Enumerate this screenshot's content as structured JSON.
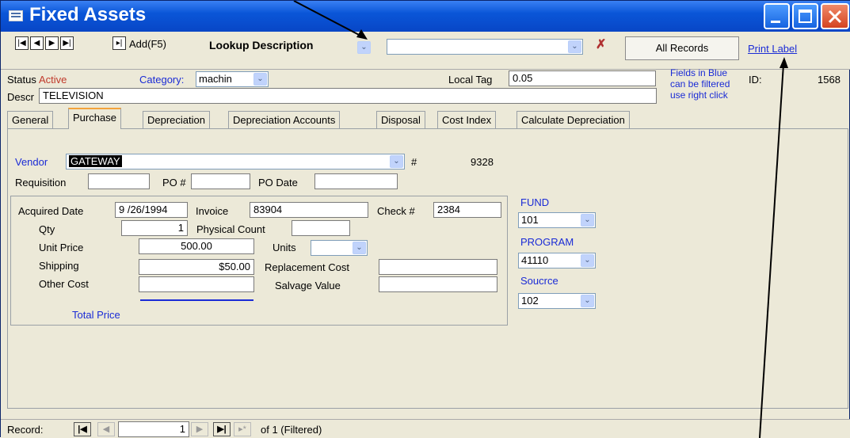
{
  "window": {
    "title": "Fixed Assets"
  },
  "toolbar": {
    "add_label": "Add(F5)",
    "lookup_label": "Lookup Description",
    "all_records_label": "All Records",
    "print_label_link": "Print Label"
  },
  "header": {
    "status_label": "Status",
    "status_value": "Active",
    "category_label": "Category:",
    "category_value": "machin",
    "local_tag_label": "Local Tag",
    "local_tag_value": "0.05",
    "hint_line1": "Fields in Blue",
    "hint_line2": "can be filtered",
    "hint_line3": "use right click",
    "id_label": "ID:",
    "id_value": "1568",
    "descr_label": "Descr",
    "descr_value": "TELEVISION"
  },
  "tabs": [
    "General",
    "Purchase",
    "Depreciation",
    "Depreciation Accounts",
    "Disposal",
    "Cost Index",
    "Calculate Depreciation"
  ],
  "purchase": {
    "vendor_label": "Vendor",
    "vendor_value": "GATEWAY",
    "vendor_num_label": "#",
    "vendor_num_value": "9328",
    "requisition_label": "Requisition",
    "requisition_value": "",
    "po_label": "PO #",
    "po_value": "",
    "po_date_label": "PO Date",
    "po_date_value": "",
    "acquired_label": "Acquired Date",
    "acquired_value": "9 /26/1994",
    "invoice_label": "Invoice",
    "invoice_value": "83904",
    "check_label": "Check #",
    "check_value": "2384",
    "qty_label": "Qty",
    "qty_value": "1",
    "physical_count_label": "Physical Count",
    "physical_count_value": "",
    "unit_price_label": "Unit Price",
    "unit_price_value": "500.00",
    "units_label": "Units",
    "units_value": "",
    "shipping_label": "Shipping",
    "shipping_value": "$50.00",
    "replacement_cost_label": "Replacement Cost",
    "replacement_cost_value": "",
    "other_cost_label": "Other Cost",
    "other_cost_value": "",
    "salvage_value_label": "Salvage Value",
    "salvage_value_value": "",
    "total_price_label": "Total Price",
    "fund_label": "FUND",
    "fund_value": "101",
    "program_label": "PROGRAM",
    "program_value": "41110",
    "source_label": "Soucrce",
    "source_value": "102"
  },
  "record_nav": {
    "record_label": "Record:",
    "current": "1",
    "of_text": "of  1 (Filtered)"
  },
  "colors": {
    "title_bar": "#0a56d8",
    "filter_blue": "#1a2bd6",
    "status_red": "#c0392b"
  }
}
